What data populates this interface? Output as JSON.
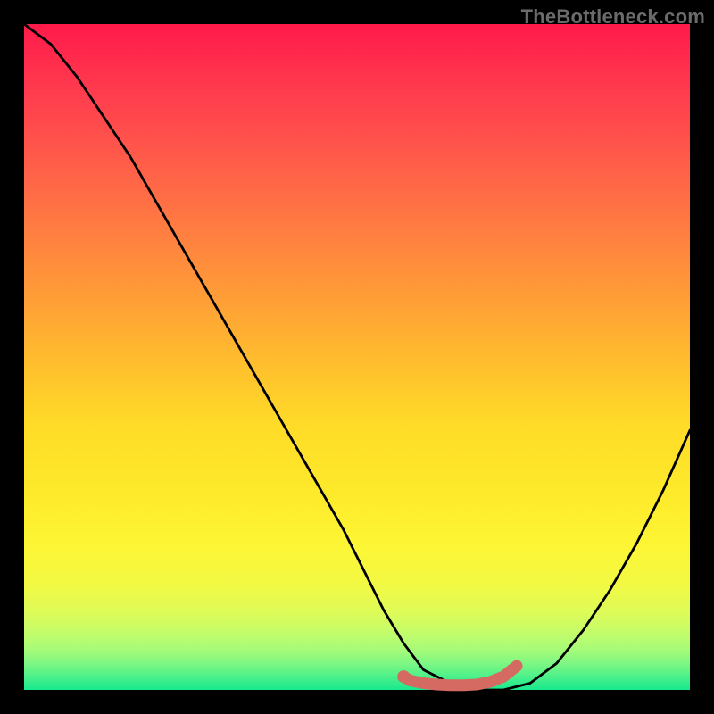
{
  "watermark": "TheBottleneck.com",
  "chart_data": {
    "type": "line",
    "title": "",
    "xlabel": "",
    "ylabel": "",
    "xlim": [
      0,
      100
    ],
    "ylim": [
      0,
      100
    ],
    "series": [
      {
        "name": "bottleneck-curve",
        "x": [
          0,
          4,
          8,
          12,
          16,
          20,
          24,
          28,
          32,
          36,
          40,
          44,
          48,
          51,
          54,
          57,
          60,
          64,
          68,
          72,
          76,
          80,
          84,
          88,
          92,
          96,
          100
        ],
        "y": [
          100,
          97,
          92,
          86,
          80,
          73,
          66,
          59,
          52,
          45,
          38,
          31,
          24,
          18,
          12,
          7,
          3,
          1,
          0,
          0,
          1,
          4,
          9,
          15,
          22,
          30,
          39
        ]
      },
      {
        "name": "optimal-marker",
        "x": [
          57,
          58,
          60,
          62,
          64,
          66,
          68,
          70,
          72,
          73,
          74
        ],
        "y": [
          2.0,
          1.4,
          1.0,
          0.8,
          0.7,
          0.7,
          0.8,
          1.2,
          2.0,
          2.8,
          3.6
        ]
      }
    ],
    "marker_color": "#d46a62",
    "curve_color": "#000000"
  }
}
